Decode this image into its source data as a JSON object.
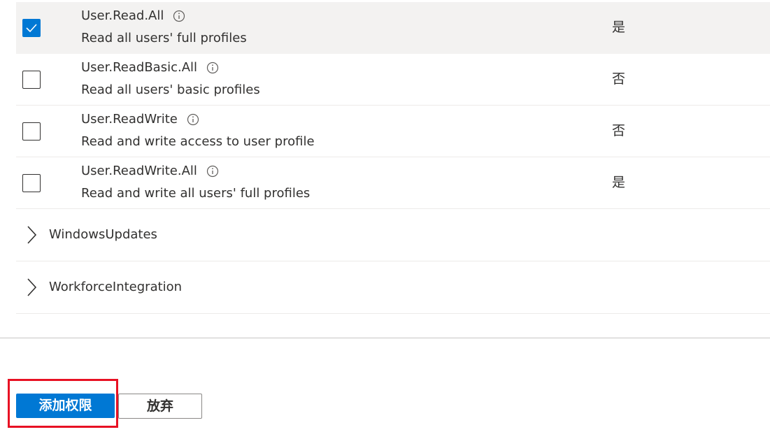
{
  "permissions": [
    {
      "name": "User.Read.All",
      "description": "Read all users' full profiles",
      "admin_consent": "是",
      "checked": true
    },
    {
      "name": "User.ReadBasic.All",
      "description": "Read all users' basic profiles",
      "admin_consent": "否",
      "checked": false
    },
    {
      "name": "User.ReadWrite",
      "description": "Read and write access to user profile",
      "admin_consent": "否",
      "checked": false
    },
    {
      "name": "User.ReadWrite.All",
      "description": "Read and write all users' full profiles",
      "admin_consent": "是",
      "checked": false
    }
  ],
  "groups": [
    {
      "label": "WindowsUpdates"
    },
    {
      "label": "WorkforceIntegration"
    }
  ],
  "footer": {
    "add_label": "添加权限",
    "discard_label": "放弃"
  },
  "icons": {
    "info": "info-icon",
    "chevron": "chevron-right-icon",
    "check": "checkmark-icon"
  },
  "colors": {
    "primary": "#0078d4",
    "selected_row": "#f3f2f1",
    "highlight": "#e81123"
  }
}
